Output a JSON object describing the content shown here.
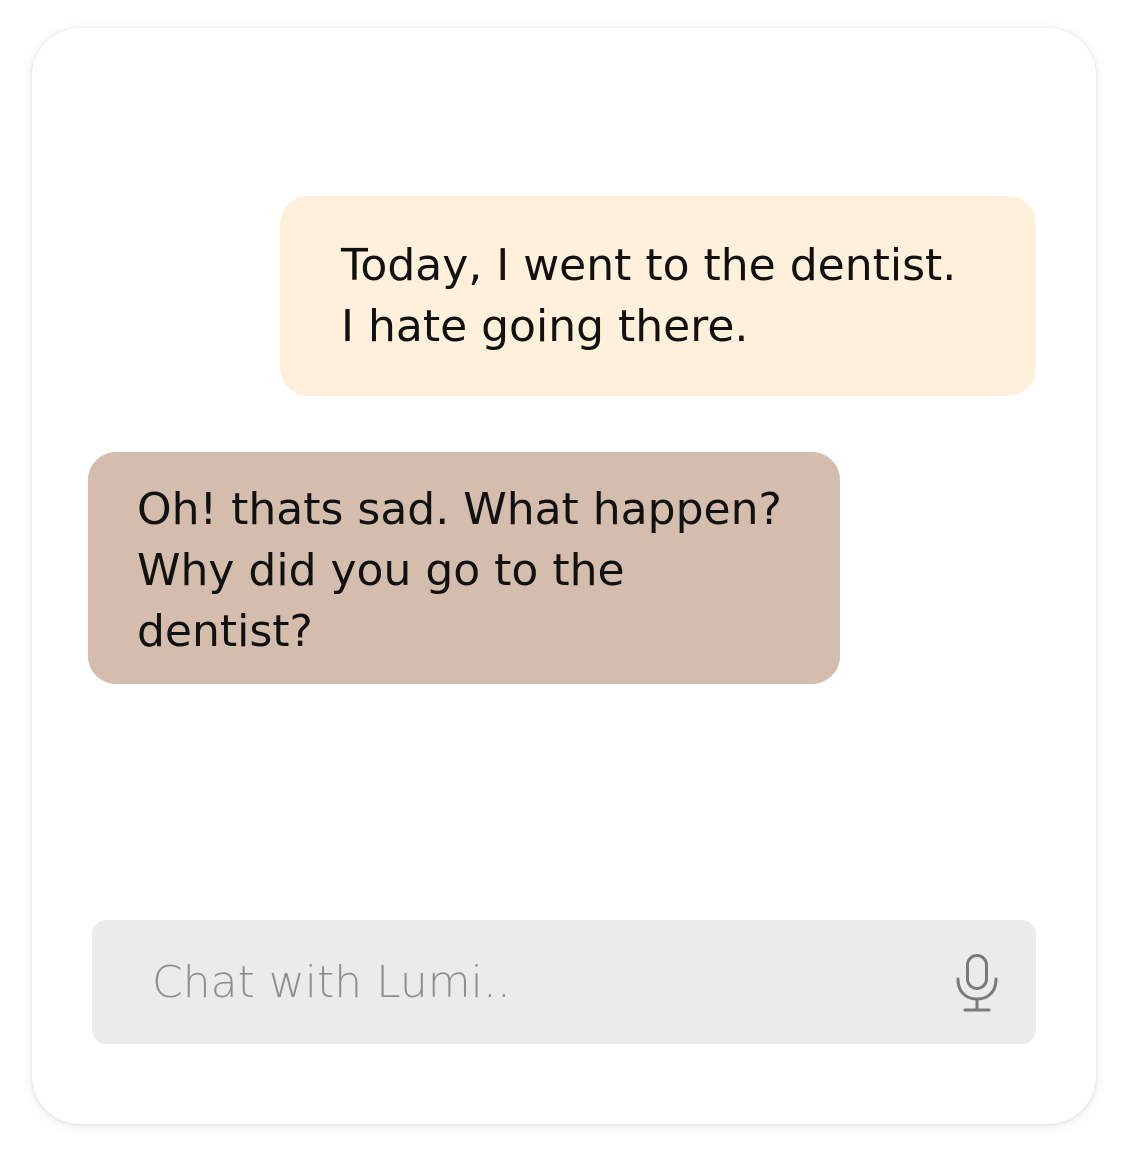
{
  "theme": {
    "user_bubble_color": "#fff0dc",
    "bot_bubble_color": "#d4bdad",
    "input_bg_color": "#ebebeb",
    "icon_color": "#7a7a7a"
  },
  "conversation": {
    "messages": [
      {
        "sender": "user",
        "lines": [
          "Today, I went to the dentist.",
          "I hate going there."
        ]
      },
      {
        "sender": "assistant",
        "lines": [
          "Oh! thats sad. What happen?",
          "Why did you go to the",
          "dentist?"
        ]
      }
    ]
  },
  "composer": {
    "placeholder": "Chat with Lumi..",
    "value": "",
    "mic_icon": "microphone-icon"
  }
}
